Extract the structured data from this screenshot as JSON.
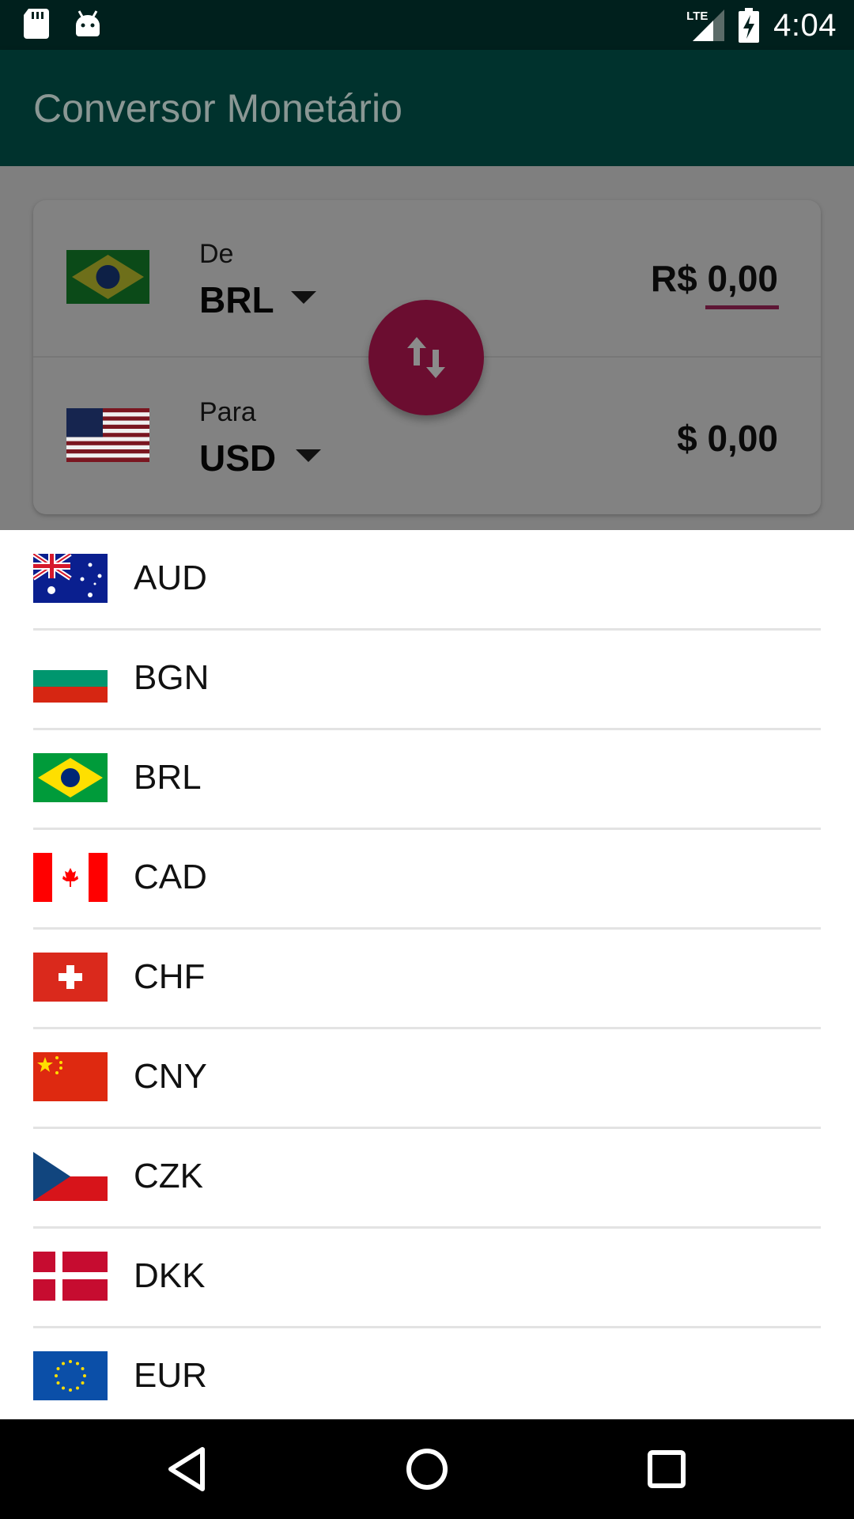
{
  "status_bar": {
    "time": "4:04",
    "network": "LTE",
    "icons": [
      "sd-card-icon",
      "android-icon",
      "lte-signal-icon",
      "battery-charging-icon"
    ]
  },
  "app_bar": {
    "title": "Conversor Monetário"
  },
  "converter": {
    "from": {
      "label": "De",
      "code": "BRL",
      "amount": "R$ 0,00",
      "flag": "brazil-flag-icon"
    },
    "to": {
      "label": "Para",
      "code": "USD",
      "amount": "$ 0,00",
      "flag": "usa-flag-icon"
    },
    "swap_icon": "swap-vertical-icon"
  },
  "currency_list": {
    "items": [
      {
        "code": "AUD",
        "flag": "australia-flag-icon"
      },
      {
        "code": "BGN",
        "flag": "bulgaria-flag-icon"
      },
      {
        "code": "BRL",
        "flag": "brazil-flag-icon"
      },
      {
        "code": "CAD",
        "flag": "canada-flag-icon"
      },
      {
        "code": "CHF",
        "flag": "switzerland-flag-icon"
      },
      {
        "code": "CNY",
        "flag": "china-flag-icon"
      },
      {
        "code": "CZK",
        "flag": "czech-flag-icon"
      },
      {
        "code": "DKK",
        "flag": "denmark-flag-icon"
      },
      {
        "code": "EUR",
        "flag": "eu-flag-icon"
      }
    ]
  },
  "nav_bar": {
    "buttons": [
      "back-icon",
      "home-icon",
      "recents-icon"
    ]
  },
  "colors": {
    "status_bar": "#00201d",
    "app_bar": "#00322d",
    "accent": "#6b0d30",
    "scrim": "#7f7f7f"
  }
}
